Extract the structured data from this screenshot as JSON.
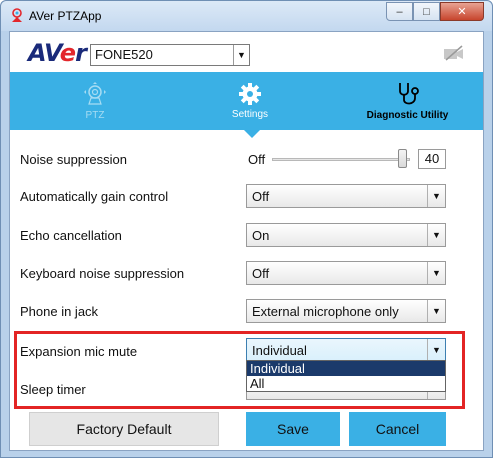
{
  "window": {
    "title": "AVer PTZApp",
    "controls": {
      "minimize": "–",
      "maximize": "□",
      "close": "✕"
    }
  },
  "brand": {
    "logo_a": "AV",
    "logo_e": "e",
    "logo_r": "r",
    "device": "FONE520"
  },
  "tabs": {
    "ptz": "PTZ",
    "settings": "Settings",
    "diagnostic": "Diagnostic Utility",
    "active": "settings"
  },
  "settings": {
    "noise_suppression": {
      "label": "Noise suppression",
      "min_label": "Off",
      "value": "40",
      "level_fraction": 0.98
    },
    "auto_gain": {
      "label": "Automatically gain control",
      "value": "Off"
    },
    "echo_cancel": {
      "label": "Echo cancellation",
      "value": "On"
    },
    "keyboard_noise": {
      "label": "Keyboard noise suppression",
      "value": "Off"
    },
    "phone_jack": {
      "label": "Phone in jack",
      "value": "External microphone only"
    },
    "expansion_mute": {
      "label": "Expansion mic mute",
      "value": "Individual",
      "options": [
        "Individual",
        "All"
      ]
    },
    "sleep_timer": {
      "label": "Sleep timer"
    }
  },
  "buttons": {
    "factory_default": "Factory Default",
    "save": "Save",
    "cancel": "Cancel"
  },
  "colors": {
    "accent": "#3ab0e5",
    "highlight": "#e32424",
    "logo_blue": "#1a2a7a",
    "logo_red": "#e3262b"
  }
}
